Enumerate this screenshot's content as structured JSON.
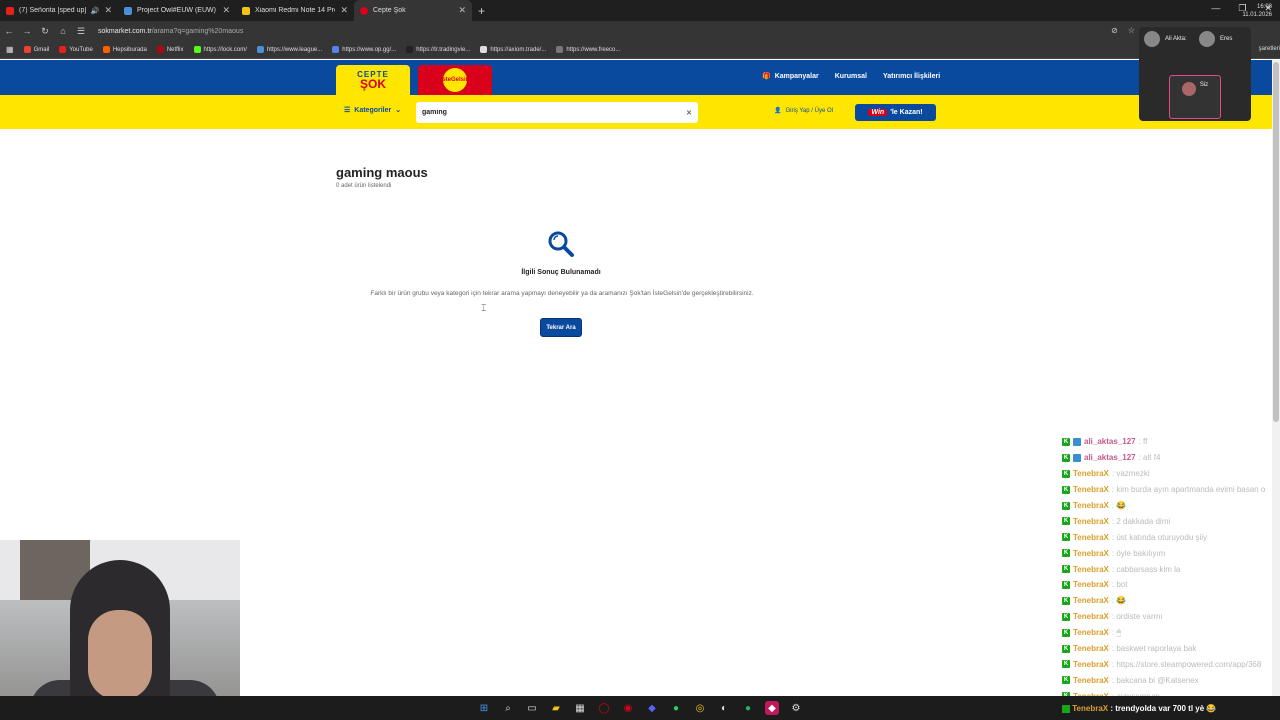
{
  "browser": {
    "tabs": [
      {
        "title": "(7) Señorita [sped up] - You",
        "color": "#e62117"
      },
      {
        "title": "Project Owl#EUW (EUW) - Lea",
        "color": "#4a90d9"
      },
      {
        "title": "Xiaomi Redmi Note 14 Pro Plu",
        "color": "#f3c21b"
      },
      {
        "title": "Cepte Şok",
        "color": "#d9001b"
      }
    ],
    "url_host": "sokmarket.com.tr",
    "url_path": "/arama?q=gaming%20maous",
    "bookmarks": [
      "Gmail",
      "YouTube",
      "Hepsiburada",
      "Netflix",
      "https://lock.com/",
      "https://www.league...",
      "https://www.op.gg/...",
      "https://tr.tradingvie...",
      "https://axiom.trade/...",
      "https://www.freeco..."
    ],
    "bookmarks_right": "şaretleri"
  },
  "meeting": {
    "participants": [
      "Ali Akta:",
      "Eres"
    ],
    "self": "Siz"
  },
  "site": {
    "logo_top": "CEPTE",
    "logo_bottom": "ŞOK",
    "logo2": "İsteGelsin",
    "nav": [
      "Kampanyalar",
      "Kurumsal",
      "Yatırımcı İlişkileri"
    ],
    "categories": "Kategoriler",
    "search_value": "gaming",
    "login": "Giriş Yap / Üye Ol",
    "win_badge": "Win",
    "win_text": "'le Kazan!"
  },
  "results": {
    "query": "gaming maous",
    "count_text": "0 adet ürün listelendi",
    "no_result_title": "İlgili Sonuç Bulunamadı",
    "description": "Farklı bir ürün grubu veya kategori için tekrar arama yapmayı deneyebilir ya da aramanızı Şok'tan İsteGelsin'de gerçekleştirebilirsiniz.",
    "retry_button": "Tekrar Ara"
  },
  "chat": [
    {
      "user": "ali_aktas_127",
      "msg": ": ff",
      "style": "pink"
    },
    {
      "user": "ali_aktas_127",
      "msg": ": alt f4",
      "style": "pink"
    },
    {
      "user": "TenebraX",
      "msg": ": vazmezki",
      "style": "gold"
    },
    {
      "user": "TenebraX",
      "msg": ": kim burda ayın apartmanda evimi basan o",
      "style": "gold"
    },
    {
      "user": "TenebraX",
      "msg": ": 😂",
      "style": "gold"
    },
    {
      "user": "TenebraX",
      "msg": ": 2 dakkada dimi",
      "style": "gold"
    },
    {
      "user": "TenebraX",
      "msg": ": üst katında oturuyodu şiiy",
      "style": "gold"
    },
    {
      "user": "TenebraX",
      "msg": ": öyle bakılıyım",
      "style": "gold"
    },
    {
      "user": "TenebraX",
      "msg": ": cabbarsass kim la",
      "style": "gold"
    },
    {
      "user": "TenebraX",
      "msg": ": bot",
      "style": "gold"
    },
    {
      "user": "TenebraX",
      "msg": ": 😂",
      "style": "gold"
    },
    {
      "user": "TenebraX",
      "msg": ": ordiste varmı",
      "style": "gold"
    },
    {
      "user": "TenebraX",
      "msg": ": 🖱",
      "style": "gold"
    },
    {
      "user": "TenebraX",
      "msg": ": baskwet raporlaya bak",
      "style": "gold"
    },
    {
      "user": "TenebraX",
      "msg": ": https://store.steampowered.com/app/368",
      "style": "gold"
    },
    {
      "user": "TenebraX",
      "msg": ": bakcana bi @Katsenex",
      "style": "gold"
    },
    {
      "user": "TenebraX",
      "msg": ": aynısıyorum",
      "style": "gold"
    }
  ],
  "chat_last": {
    "user": "TenebraX",
    "msg": ": trendyolda var 700 tl yè 😂"
  },
  "taskbar": {
    "time": "16:08",
    "date": "11.01.2026"
  }
}
